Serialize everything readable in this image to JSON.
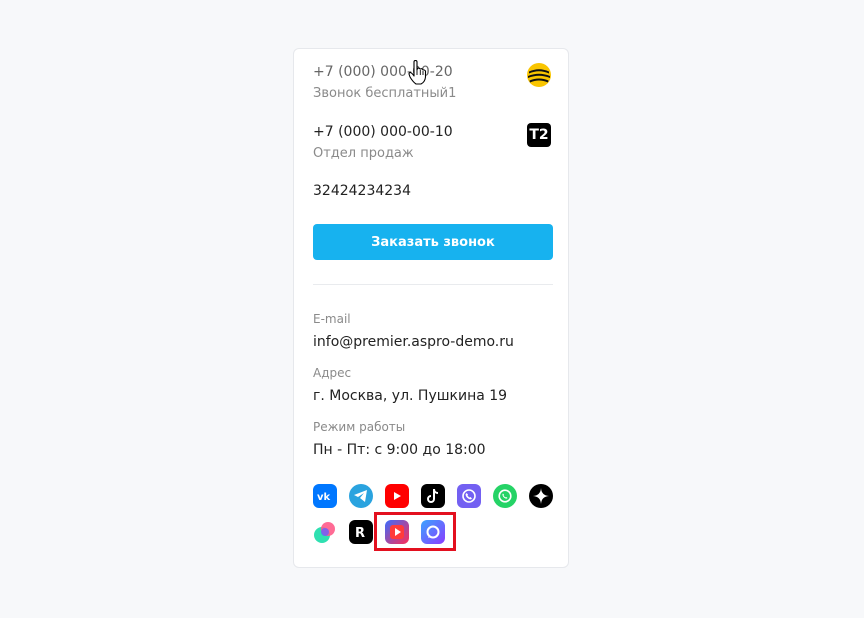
{
  "phones": [
    {
      "number": "+7 (000) 000-00-20",
      "note": "Звонок бесплатный1",
      "operator_icon": "beeline-logo-icon"
    },
    {
      "number": "+7 (000) 000-00-10",
      "note": "Отдел продаж",
      "operator_icon": "t2-logo-icon",
      "operator_text": "T2"
    }
  ],
  "plain_number": "32424234234",
  "order_button_label": "Заказать звонок",
  "email": {
    "label": "E-mail",
    "value": "info@premier.aspro-demo.ru"
  },
  "address": {
    "label": "Адрес",
    "value": "г. Москва, ул. Пушкина 19"
  },
  "hours": {
    "label": "Режим работы",
    "value": "Пн - Пт: с 9:00 до 18:00"
  },
  "social_icons": [
    "vk-icon",
    "telegram-icon",
    "youtube-icon",
    "tiktok-icon",
    "viber-icon",
    "whatsapp-icon",
    "zen-icon",
    "odnoklassniki-icon",
    "rutube-icon",
    "vk-video-icon",
    "max-messenger-icon"
  ],
  "colors": {
    "accent": "#17b2ef",
    "highlight": "#e3101f"
  }
}
